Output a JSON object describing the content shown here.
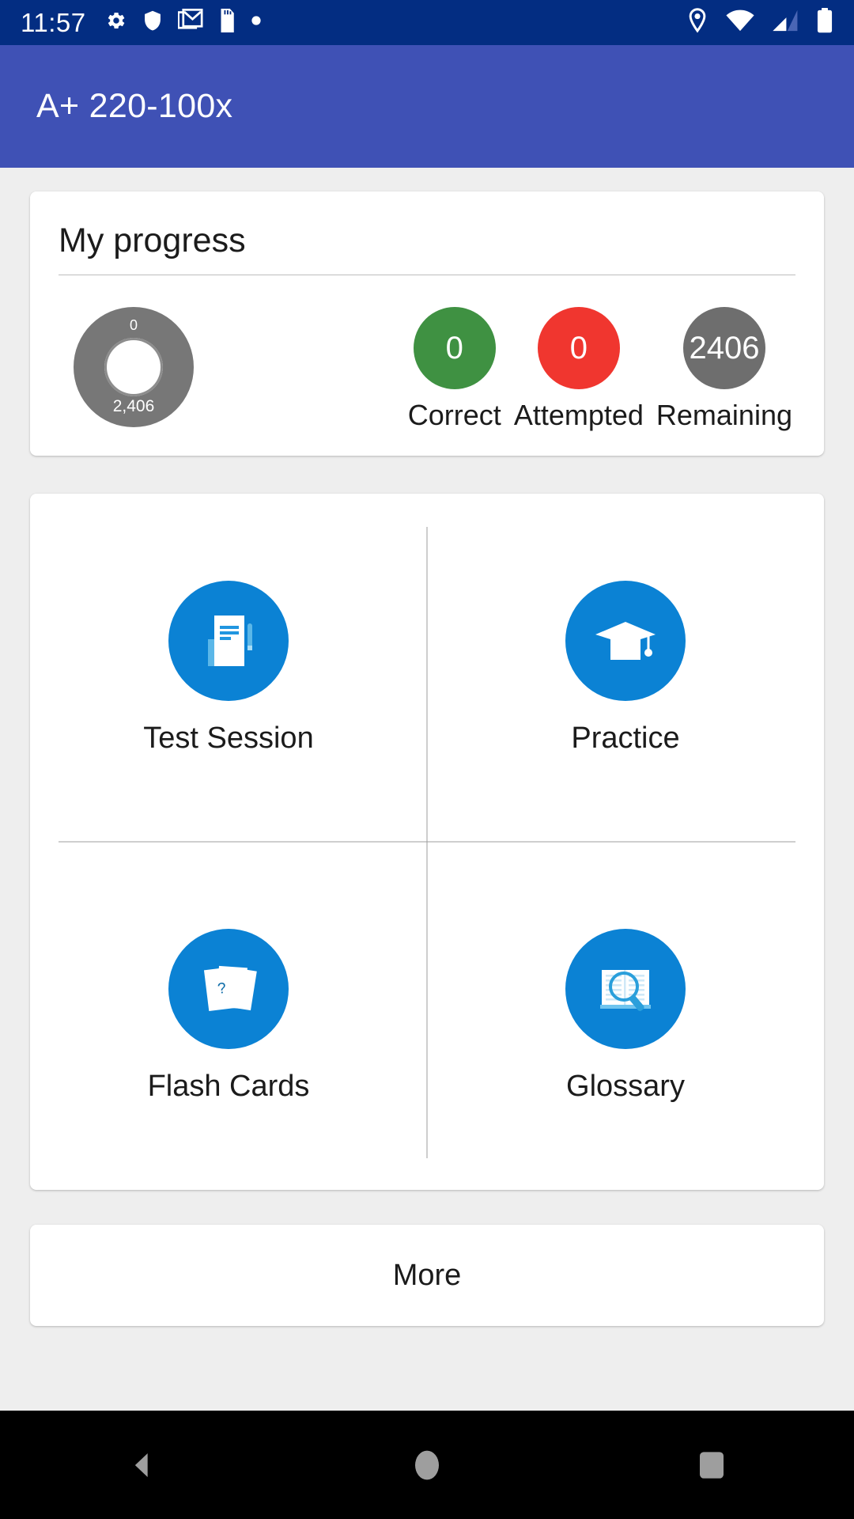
{
  "status_bar": {
    "time": "11:57",
    "left_icons": [
      "gear-icon",
      "shield-icon",
      "gmail-icon",
      "sdcard-icon",
      "dot-icon"
    ],
    "right_icons": [
      "location-icon",
      "wifi-icon",
      "cellular-signal-icon",
      "battery-icon"
    ],
    "background_color": "#032d82"
  },
  "app_bar": {
    "title": "A+ 220-100x",
    "background_color": "#3f51b5"
  },
  "progress": {
    "title": "My progress",
    "donut": {
      "top_label": "0",
      "bottom_label": "2,406",
      "track_color": "#777777",
      "progress_percent": 0
    },
    "stats": [
      {
        "value": "0",
        "label": "Correct",
        "color": "#3f9142"
      },
      {
        "value": "0",
        "label": "Attempted",
        "color": "#f0362f"
      },
      {
        "value": "2406",
        "label": "Remaining",
        "color": "#6e6e6e"
      }
    ]
  },
  "menu": {
    "accent_color": "#0b82d4",
    "tiles": [
      {
        "label": "Test Session",
        "icon": "document-pen-icon"
      },
      {
        "label": "Practice",
        "icon": "graduation-cap-icon"
      },
      {
        "label": "Flash Cards",
        "icon": "flash-cards-icon"
      },
      {
        "label": "Glossary",
        "icon": "book-magnifier-icon"
      }
    ],
    "more_label": "More"
  },
  "nav_bar": {
    "buttons": [
      "back-button",
      "home-button",
      "recents-button"
    ]
  }
}
